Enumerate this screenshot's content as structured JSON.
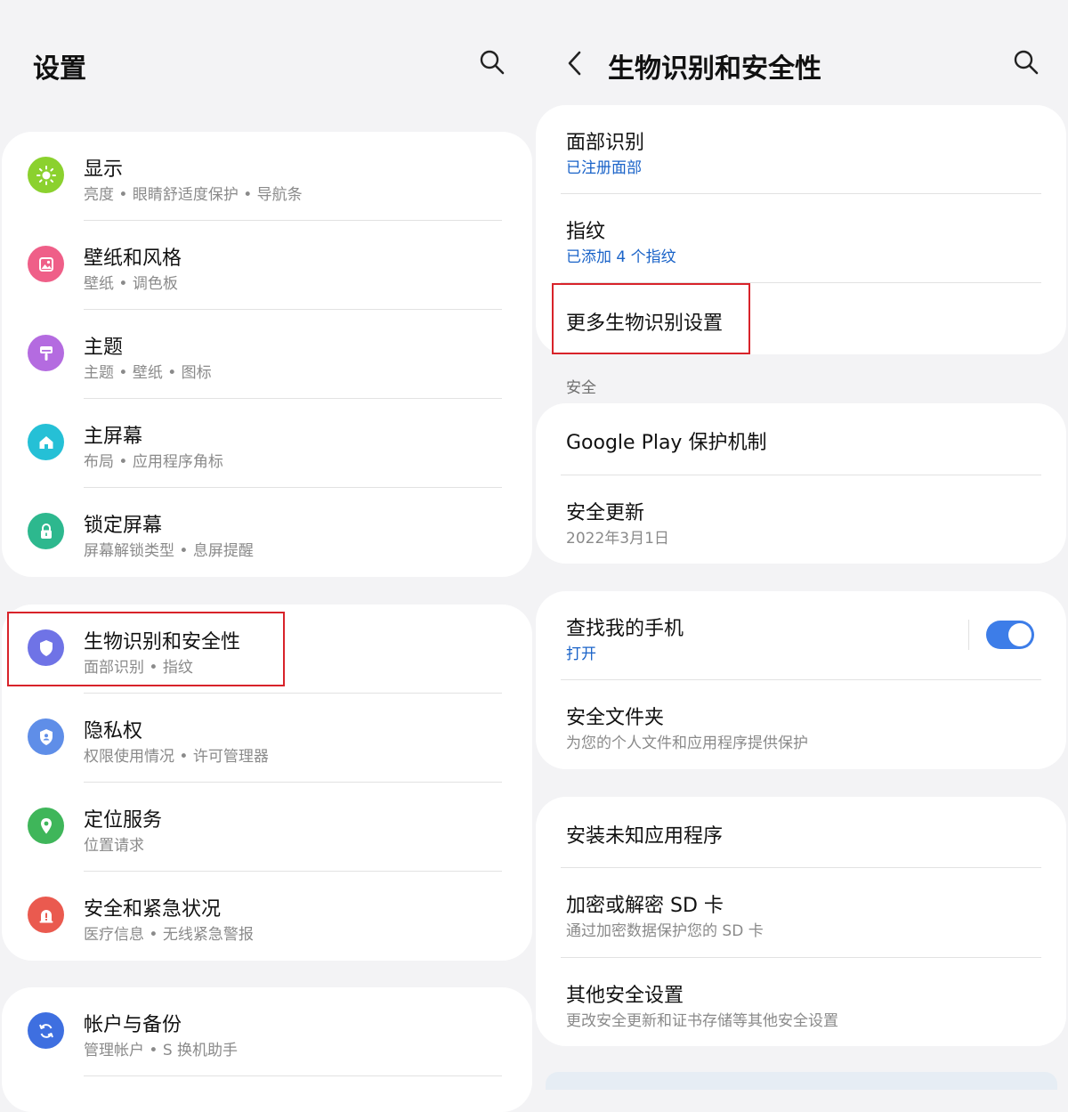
{
  "left": {
    "title": "设置",
    "groups": [
      {
        "items": [
          {
            "title": "显示",
            "sub": "亮度 • 眼睛舒适度保护 • 导航条",
            "icon": "sun-icon",
            "color": "#8bd12e"
          },
          {
            "title": "壁纸和风格",
            "sub": "壁纸 • 调色板",
            "icon": "image-icon",
            "color": "#ef5f88"
          },
          {
            "title": "主题",
            "sub": "主题 • 壁纸 • 图标",
            "icon": "brush-icon",
            "color": "#b46be0"
          },
          {
            "title": "主屏幕",
            "sub": "布局 • 应用程序角标",
            "icon": "home-icon",
            "color": "#25c0d6"
          },
          {
            "title": "锁定屏幕",
            "sub": "屏幕解锁类型 • 息屏提醒",
            "icon": "lock-icon",
            "color": "#2db88e"
          }
        ]
      },
      {
        "items": [
          {
            "title": "生物识别和安全性",
            "sub": "面部识别 • 指纹",
            "icon": "shield-icon",
            "color": "#6f73e6"
          },
          {
            "title": "隐私权",
            "sub": "权限使用情况 • 许可管理器",
            "icon": "privacy-shield-icon",
            "color": "#5f8ee8"
          },
          {
            "title": "定位服务",
            "sub": "位置请求",
            "icon": "location-pin-icon",
            "color": "#3fb65a"
          },
          {
            "title": "安全和紧急状况",
            "sub": "医疗信息 • 无线紧急警报",
            "icon": "alert-icon",
            "color": "#ea5a4f"
          }
        ]
      },
      {
        "items": [
          {
            "title": "帐户与备份",
            "sub": "管理帐户 • S 换机助手",
            "icon": "sync-icon",
            "color": "#3e6fe0"
          }
        ]
      }
    ]
  },
  "right": {
    "title": "生物识别和安全性",
    "biometrics": {
      "face_title": "面部识别",
      "face_sub": "已注册面部",
      "finger_title": "指纹",
      "finger_sub": "已添加 4 个指纹",
      "more_title": "更多生物识别设置"
    },
    "security_label": "安全",
    "security": {
      "gplay_title": "Google Play 保护机制",
      "update_title": "安全更新",
      "update_sub": "2022年3月1日"
    },
    "find": {
      "find_title": "查找我的手机",
      "find_sub": "打开",
      "find_on": true,
      "folder_title": "安全文件夹",
      "folder_sub": "为您的个人文件和应用程序提供保护"
    },
    "other": {
      "unknown_title": "安装未知应用程序",
      "sd_title": "加密或解密 SD 卡",
      "sd_sub": "通过加密数据保护您的 SD 卡",
      "more_title": "其他安全设置",
      "more_sub": "更改安全更新和证书存储等其他安全设置"
    }
  },
  "colors": {
    "accent": "#3d7de8",
    "link": "#1a63c8",
    "highlight": "#d8232a"
  }
}
